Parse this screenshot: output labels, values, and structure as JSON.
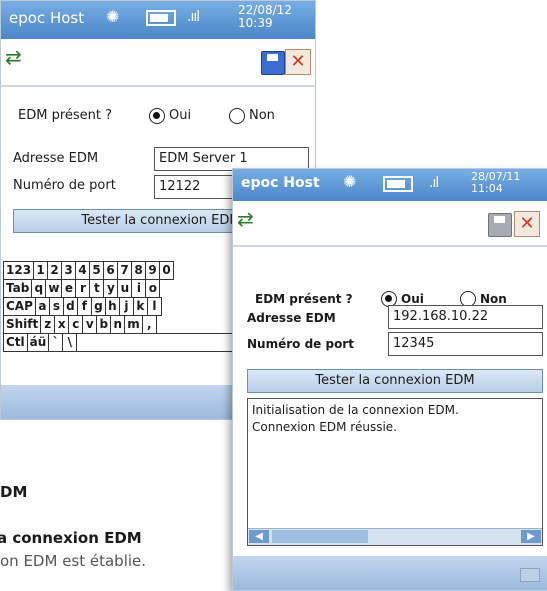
{
  "screen1": {
    "app_title": "epoc Host",
    "date": "22/08/12",
    "time": "10:39",
    "edm_question": "EDM présent ?",
    "opt_oui": "Oui",
    "opt_non": "Non",
    "selected": "Oui",
    "addr_label": "Adresse EDM",
    "addr_value": "EDM Server 1",
    "port_label": "Numéro de port",
    "port_value": "12122",
    "test_button": "Tester la connexion EDM",
    "keyboard": [
      [
        "123",
        "1",
        "2",
        "3",
        "4",
        "5",
        "6",
        "7",
        "8",
        "9",
        "0"
      ],
      [
        "Tab",
        "q",
        "w",
        "e",
        "r",
        "t",
        "y",
        "u",
        "i",
        "o"
      ],
      [
        "CAP",
        "a",
        "s",
        "d",
        "f",
        "g",
        "h",
        "j",
        "k",
        "l"
      ],
      [
        "Shift",
        "z",
        "x",
        "c",
        "v",
        "b",
        "n",
        "m",
        ","
      ],
      [
        "Ctl",
        "áü",
        "`",
        "\\",
        " ",
        "↓"
      ]
    ]
  },
  "screen2": {
    "app_title": "epoc Host",
    "date": "28/07/11",
    "time": "11:04",
    "edm_question": "EDM présent ?",
    "opt_oui": "Oui",
    "opt_non": "Non",
    "selected": "Oui",
    "addr_label": "Adresse EDM",
    "addr_value": "192.168.10.22",
    "port_label": "Numéro de port",
    "port_value": "12345",
    "test_button": "Tester la connexion EDM",
    "log_lines": [
      "Initialisation de la connexion EDM.",
      "Connexion EDM réussie."
    ]
  },
  "doc_text": {
    "heading_fragment": "DM",
    "subheading_fragment": "a connexion EDM",
    "body_fragment": "on EDM est établie."
  },
  "colors": {
    "titlebar": "#4b86c8",
    "button": "#c8dbef",
    "accent_close": "#d33a1a"
  }
}
